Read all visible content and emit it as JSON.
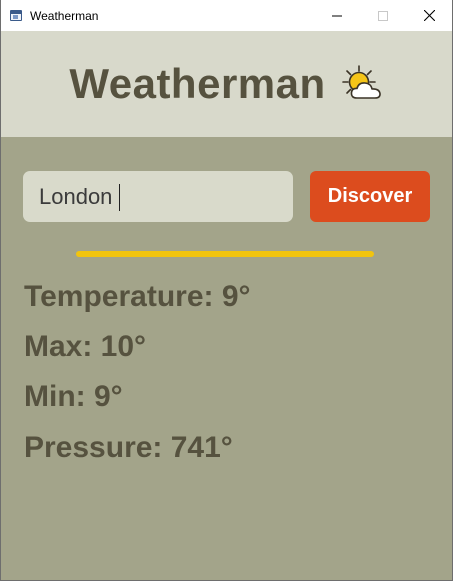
{
  "window": {
    "title": "Weatherman",
    "icon": "app-window-icon"
  },
  "header": {
    "title": "Weatherman",
    "icon": "sun-behind-cloud-icon"
  },
  "search": {
    "value": "London",
    "button_label": "Discover"
  },
  "progress": {
    "value": 1.0,
    "color": "#f1c40f"
  },
  "stats": {
    "temperature": "Temperature: 9°",
    "max": "Max: 10°",
    "min": "Min: 9°",
    "pressure": "Pressure: 741°"
  },
  "colors": {
    "header_bg": "#d8d9cb",
    "main_bg": "#a3a48a",
    "text": "#56523f",
    "button_bg": "#dc4c1e",
    "accent": "#f1c40f"
  }
}
